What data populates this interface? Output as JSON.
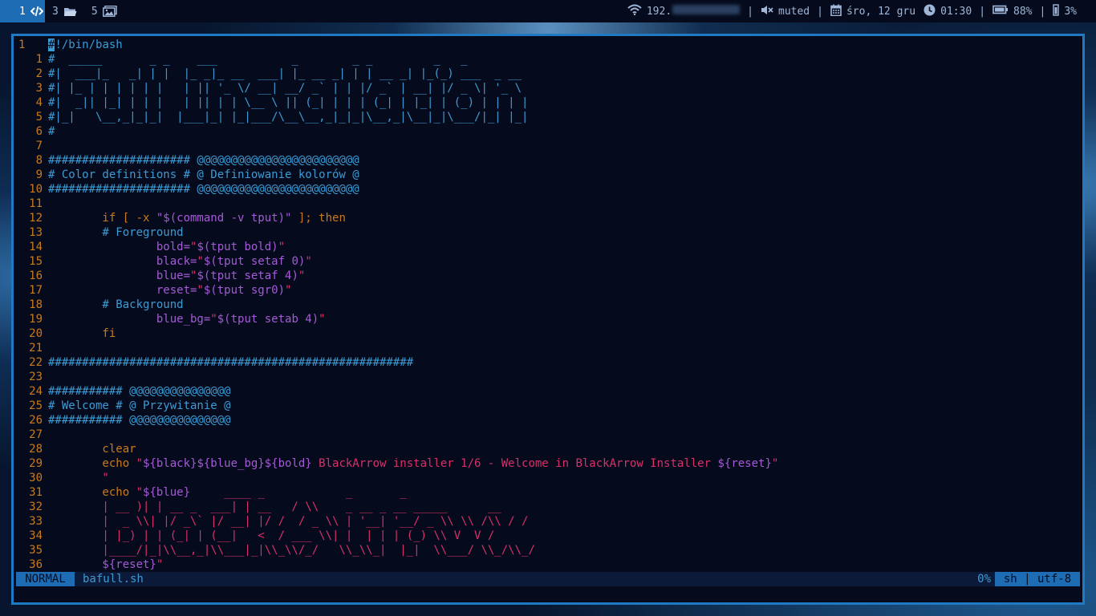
{
  "topbar": {
    "workspaces": [
      {
        "num": "1",
        "icon": "code-icon",
        "active": true
      },
      {
        "num": "3",
        "icon": "folder-icon",
        "active": false
      },
      {
        "num": "5",
        "icon": "image-icon",
        "active": false
      }
    ],
    "network": "192.",
    "volume": "muted",
    "date": "śro, 12 gru",
    "time": "01:30",
    "battery": "88%",
    "cpu": "3%"
  },
  "editor": {
    "mode": "NORMAL",
    "filename": "bafull.sh",
    "percent": "0%",
    "filetype": "sh | utf-8",
    "lines": [
      {
        "n": "1",
        "cur": true,
        "segs": [
          [
            "cursor",
            "#"
          ],
          [
            "blue",
            "!/bin/bash"
          ]
        ]
      },
      {
        "n": "1",
        "segs": [
          [
            "blue",
            "#  _____       _ _    ___           _        _ _         _   _"
          ]
        ]
      },
      {
        "n": "2",
        "segs": [
          [
            "blue",
            "#|  ___|_   _| | |  |_ _|_ __  ___| |_ __ _| | | __ _| |_(_) ___  _ __"
          ]
        ]
      },
      {
        "n": "3",
        "segs": [
          [
            "blue",
            "#| |_ | | | | | |   | || '_ \\/ __| __/ _` | | |/ _` | __| |/ _ \\| '_ \\"
          ]
        ]
      },
      {
        "n": "4",
        "segs": [
          [
            "blue",
            "#|  _|| |_| | | |   | || | | \\__ \\ || (_| | | | (_| | |_| | (_) | | | |"
          ]
        ]
      },
      {
        "n": "5",
        "segs": [
          [
            "blue",
            "#|_|   \\__,_|_|_|  |___|_| |_|___/\\__\\__,_|_|_|\\__,_|\\__|_|\\___/|_| |_|"
          ]
        ]
      },
      {
        "n": "6",
        "segs": [
          [
            "blue",
            "#"
          ]
        ]
      },
      {
        "n": "7",
        "segs": []
      },
      {
        "n": "8",
        "segs": [
          [
            "blue",
            "##################### @@@@@@@@@@@@@@@@@@@@@@@@"
          ]
        ]
      },
      {
        "n": "9",
        "segs": [
          [
            "blue",
            "# Color definitions # @ Definiowanie kolorów @"
          ]
        ]
      },
      {
        "n": "10",
        "segs": [
          [
            "blue",
            "##################### @@@@@@@@@@@@@@@@@@@@@@@@"
          ]
        ]
      },
      {
        "n": "11",
        "segs": []
      },
      {
        "n": "12",
        "segs": [
          [
            "orange",
            "        if [ -x "
          ],
          [
            "purple",
            "\"$(command -v tput)\""
          ],
          [
            "orange",
            " ]; then"
          ]
        ]
      },
      {
        "n": "13",
        "segs": [
          [
            "blue",
            "        # Foreground"
          ]
        ]
      },
      {
        "n": "14",
        "segs": [
          [
            "purple",
            "                bold="
          ],
          [
            "red",
            "\""
          ],
          [
            "purple",
            "$(tput bold)"
          ],
          [
            "red",
            "\""
          ]
        ]
      },
      {
        "n": "15",
        "segs": [
          [
            "purple",
            "                black="
          ],
          [
            "red",
            "\""
          ],
          [
            "purple",
            "$(tput setaf 0)"
          ],
          [
            "red",
            "\""
          ]
        ]
      },
      {
        "n": "16",
        "segs": [
          [
            "purple",
            "                blue="
          ],
          [
            "red",
            "\""
          ],
          [
            "purple",
            "$(tput setaf 4)"
          ],
          [
            "red",
            "\""
          ]
        ]
      },
      {
        "n": "17",
        "segs": [
          [
            "purple",
            "                reset="
          ],
          [
            "red",
            "\""
          ],
          [
            "purple",
            "$(tput sgr0)"
          ],
          [
            "red",
            "\""
          ]
        ]
      },
      {
        "n": "18",
        "segs": [
          [
            "blue",
            "        # Background"
          ]
        ]
      },
      {
        "n": "19",
        "segs": [
          [
            "purple",
            "                blue_bg="
          ],
          [
            "red",
            "\""
          ],
          [
            "purple",
            "$(tput setab 4)"
          ],
          [
            "red",
            "\""
          ]
        ]
      },
      {
        "n": "20",
        "segs": [
          [
            "orange",
            "        fi"
          ]
        ]
      },
      {
        "n": "21",
        "segs": []
      },
      {
        "n": "22",
        "segs": [
          [
            "blue",
            "######################################################"
          ]
        ]
      },
      {
        "n": "23",
        "segs": []
      },
      {
        "n": "24",
        "segs": [
          [
            "blue",
            "########### @@@@@@@@@@@@@@@"
          ]
        ]
      },
      {
        "n": "25",
        "segs": [
          [
            "blue",
            "# Welcome # @ Przywitanie @"
          ]
        ]
      },
      {
        "n": "26",
        "segs": [
          [
            "blue",
            "########### @@@@@@@@@@@@@@@"
          ]
        ]
      },
      {
        "n": "27",
        "segs": []
      },
      {
        "n": "28",
        "segs": [
          [
            "orange",
            "        clear"
          ]
        ]
      },
      {
        "n": "29",
        "segs": [
          [
            "orange",
            "        echo "
          ],
          [
            "red",
            "\""
          ],
          [
            "purple",
            "${black}${blue_bg}${bold}"
          ],
          [
            "red",
            " BlackArrow installer 1/6 - Welcome in BlackArrow Installer "
          ],
          [
            "purple",
            "${reset}"
          ],
          [
            "red",
            "\""
          ]
        ]
      },
      {
        "n": "30",
        "segs": [
          [
            "red",
            "        \""
          ]
        ]
      },
      {
        "n": "31",
        "segs": [
          [
            "orange",
            "        echo "
          ],
          [
            "red",
            "\""
          ],
          [
            "purple",
            "${blue}"
          ],
          [
            "red",
            "     ____ _            _       _"
          ]
        ]
      },
      {
        "n": "32",
        "segs": [
          [
            "red",
            "        | __ )| | __ _  ___| | __   / \\\\    _ __ _ __ _____      __"
          ]
        ]
      },
      {
        "n": "33",
        "segs": [
          [
            "red",
            "        |  _ \\\\| |/ _\\` |/ __| |/ /  / _ \\\\ | '__| '__/ _ \\\\ \\\\ /\\\\ / /"
          ]
        ]
      },
      {
        "n": "34",
        "segs": [
          [
            "red",
            "        | |_) | | (_| | (__|   <  / ___ \\\\| |  | | | (_) \\\\ V  V /"
          ]
        ]
      },
      {
        "n": "35",
        "segs": [
          [
            "red",
            "        |____/|_|\\\\__,_|\\\\___|_|\\\\_\\\\/_/   \\\\_\\\\_|  |_|  \\\\___/ \\\\_/\\\\_/"
          ]
        ]
      },
      {
        "n": "36",
        "segs": [
          [
            "purple",
            "        ${reset}"
          ],
          [
            "red",
            "\""
          ]
        ]
      }
    ]
  }
}
